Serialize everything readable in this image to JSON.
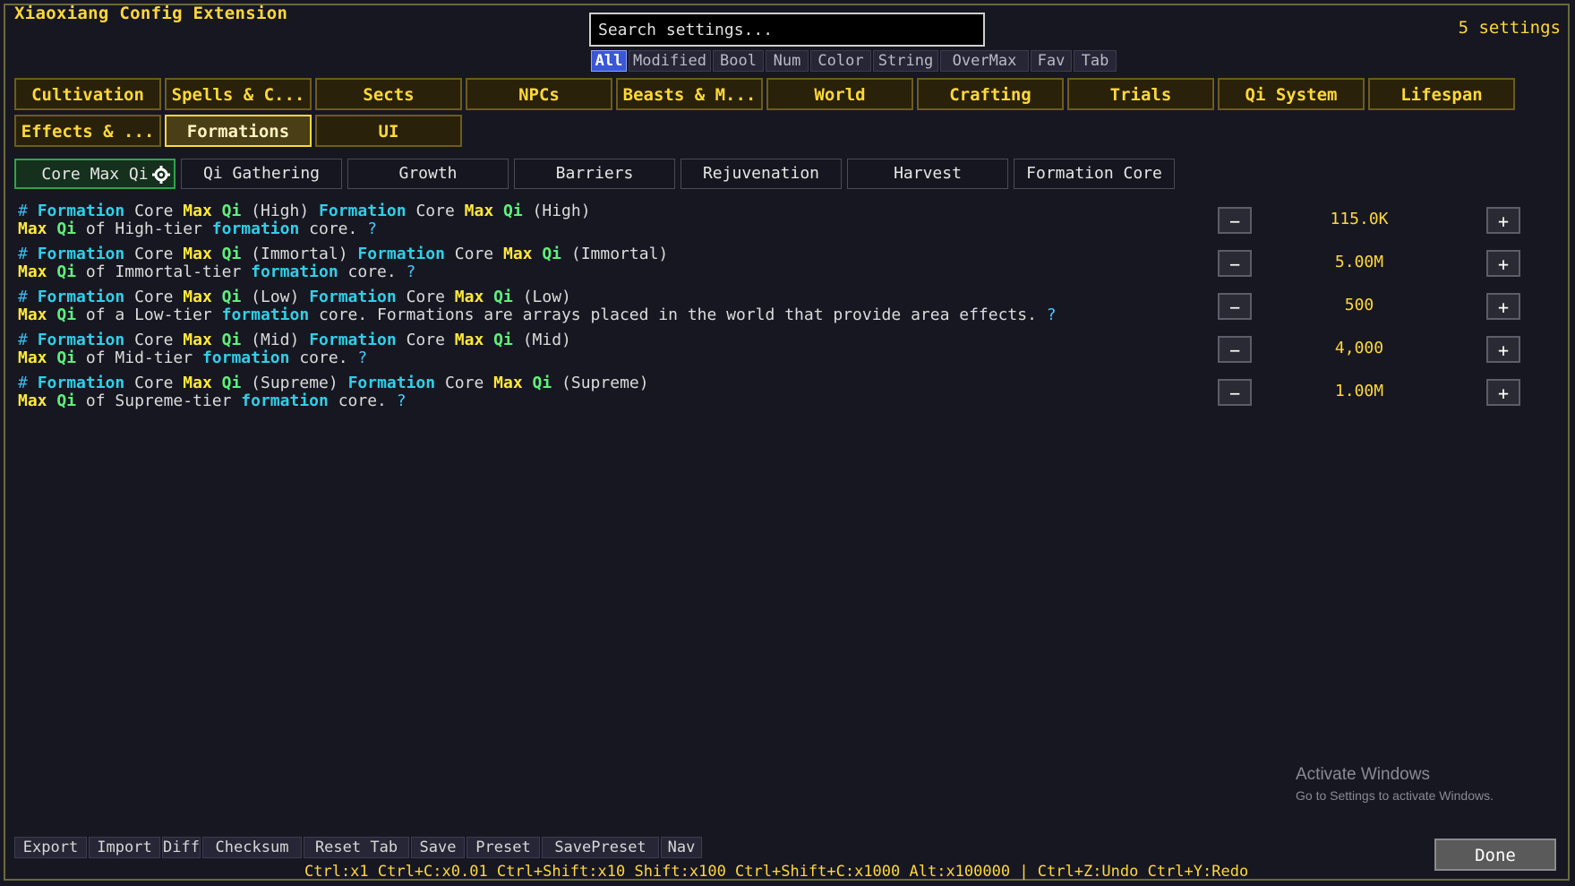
{
  "window": {
    "title": "Xiaoxiang Config Extension",
    "count": "5 settings"
  },
  "search": {
    "placeholder": "Search settings..."
  },
  "filters": [
    {
      "label": "All",
      "active": true
    },
    {
      "label": "Modified"
    },
    {
      "label": "Bool"
    },
    {
      "label": "Num"
    },
    {
      "label": "Color"
    },
    {
      "label": "String"
    },
    {
      "label": "OverMax"
    },
    {
      "label": "Fav"
    },
    {
      "label": "Tab"
    }
  ],
  "categories_row1": [
    "Cultivation",
    "Spells & C...",
    "Sects",
    "NPCs",
    "Beasts & M...",
    "World",
    "Crafting",
    "Trials",
    "Qi System",
    "Lifespan"
  ],
  "categories_row2": [
    "Effects & ...",
    "Formations",
    "UI"
  ],
  "active_category": "Formations",
  "subtabs": [
    "Core Max Qi",
    "Qi Gathering",
    "Growth",
    "Barriers",
    "Rejuvenation",
    "Harvest",
    "Formation Core"
  ],
  "settings": [
    {
      "tier": "High",
      "desc_pre": "of High-tier",
      "desc_post": "core.",
      "value": "115.0K"
    },
    {
      "tier": "Immortal",
      "desc_pre": "of Immortal-tier",
      "desc_post": "core.",
      "value": "5.00M"
    },
    {
      "tier": "Low",
      "desc_pre": "of a Low-tier",
      "desc_post": "core. Formations are arrays placed in the world that provide area effects.",
      "value": "500"
    },
    {
      "tier": "Mid",
      "desc_pre": "of Mid-tier",
      "desc_post": "core.",
      "value": "4,000"
    },
    {
      "tier": "Supreme",
      "desc_pre": "of Supreme-tier",
      "desc_post": "core.",
      "value": "1.00M"
    }
  ],
  "words": {
    "hash": "#",
    "formation": "Formation",
    "core": "Core",
    "max": "Max",
    "qi": "Qi",
    "formation_lower": "formation",
    "question": "?",
    "minus": "−",
    "plus": "+"
  },
  "bottom_buttons": [
    "Export",
    "Import",
    "Diff",
    "Checksum",
    "Reset Tab",
    "Save",
    "Preset",
    "SavePreset",
    "Nav"
  ],
  "hints": "Ctrl:x1  Ctrl+C:x0.01  Ctrl+Shift:x10  Shift:x100  Ctrl+Shift+C:x1000  Alt:x100000  |  Ctrl+Z:Undo  Ctrl+Y:Redo",
  "done_label": "Done",
  "watermark": {
    "line1": "Activate Windows",
    "line2": "Go to Settings to activate Windows."
  }
}
